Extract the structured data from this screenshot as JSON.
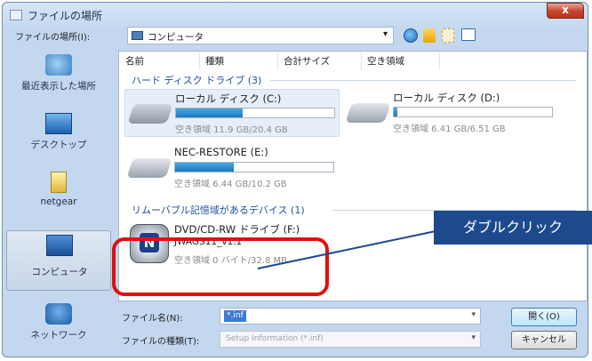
{
  "window": {
    "title": "ファイルの場所",
    "close_glyph": "x"
  },
  "lookin": {
    "label": "ファイルの場所(I):",
    "value": "コンピュータ",
    "arrow": "▾"
  },
  "places": [
    {
      "label": "最近表示した場所"
    },
    {
      "label": "デスクトップ"
    },
    {
      "label": "netgear"
    },
    {
      "label": "コンピュータ"
    },
    {
      "label": "ネットワーク"
    }
  ],
  "columns": {
    "name": "名前",
    "type": "種類",
    "total": "合計サイズ",
    "free": "空き領域"
  },
  "groups": {
    "hdd": "ハード ディスク ドライブ (3)",
    "removable": "リムーバブル記憶域があるデバイス (1)"
  },
  "drives": {
    "c": {
      "name": "ローカル ディスク (C:)",
      "free": "空き領域 11.9 GB/20.4 GB",
      "used_fraction": 0.42
    },
    "d": {
      "name": "ローカル ディスク (D:)",
      "free": "空き領域 6.41 GB/6.51 GB",
      "used_fraction": 0.02
    },
    "e": {
      "name": "NEC-RESTORE (E:)",
      "free": "空き領域 6.44 GB/10.2 GB",
      "used_fraction": 0.37
    },
    "f": {
      "name": "DVD/CD-RW ドライブ (F:)",
      "volume": "JWAGS11_v1.1",
      "free": "空き領域 0 バイト/32.8 MB"
    }
  },
  "filename": {
    "label": "ファイル名(N):",
    "value": "*.inf"
  },
  "filetype": {
    "label": "ファイルの種類(T):",
    "value": "Setup Information (*.inf)"
  },
  "buttons": {
    "open": "開く(O)",
    "cancel": "キャンセル"
  },
  "annotation": {
    "callout": "ダブルクリック"
  },
  "colors": {
    "accent": "#1d4a8c",
    "highlight": "#e01010",
    "bar": "#1d77c5"
  }
}
